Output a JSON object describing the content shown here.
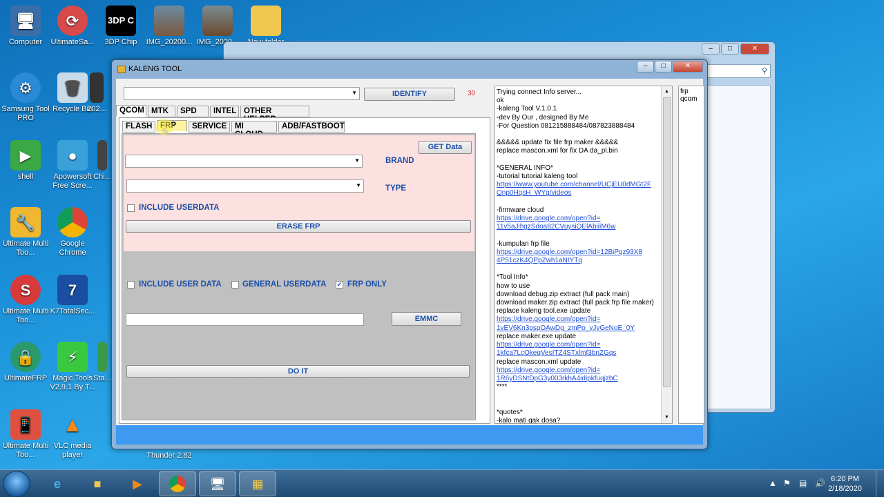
{
  "desktop": {
    "icons": [
      {
        "label": "Computer"
      },
      {
        "label": "UltimateSa..."
      },
      {
        "label": "3DP Chip",
        "glyph": "3DP C"
      },
      {
        "label": "IMG_20200..."
      },
      {
        "label": "IMG_2020..."
      },
      {
        "label": "New folder"
      },
      {
        "label": "Samsung Tool PRO"
      },
      {
        "label": "Recycle Bin"
      },
      {
        "label": "202..."
      },
      {
        "label": "shell"
      },
      {
        "label": "Apowersoft Free Scre..."
      },
      {
        "label": "Chi..."
      },
      {
        "label": "Ultimate Multi Too..."
      },
      {
        "label": "Google Chrome"
      },
      {
        "label": "Ultimate Multi Too..."
      },
      {
        "label": "K7TotalSec..."
      },
      {
        "label": "UltimateFRP"
      },
      {
        "label": "Magic Tools V2.9.1 By T..."
      },
      {
        "label": "Sta..."
      },
      {
        "label": "Ultimate Multi Too..."
      },
      {
        "label": "VLC media player"
      },
      {
        "label": "Thunder 2.82"
      }
    ]
  },
  "window": {
    "title": "KALENG TOOL",
    "minimize": "–",
    "maximize": "□",
    "close": "✕"
  },
  "top": {
    "device_combo_value": "",
    "identify_label": "IDENTIFY",
    "counter": "30"
  },
  "main_tabs": [
    "QCOM",
    "MTK",
    "SPD",
    "INTEL",
    "OTHER HELPER"
  ],
  "sub_tabs": [
    "FLASH",
    "FRP",
    "SERVICE",
    "MI CLOUD",
    "ADB/FASTBOOT"
  ],
  "frp_panel": {
    "get_data_label": "GET Data",
    "brand_label": "BRAND",
    "type_label": "TYPE",
    "include_userdata_label": "INCLUDE USERDATA",
    "erase_frp_label": "ERASE FRP"
  },
  "lower_panel": {
    "include_user_data_label": "INCLUDE USER DATA",
    "general_userdata_label": "GENERAL USERDATA",
    "frp_only_label": "FRP ONLY",
    "frp_only_checked": "✔",
    "emmc_label": "EMMC",
    "do_it_label": "DO IT"
  },
  "log_lines": [
    {
      "text": "Trying connect Info server...",
      "link": false
    },
    {
      "text": " ok",
      "link": false
    },
    {
      "text": "-kaleng Tool V.1.0.1",
      "link": false
    },
    {
      "text": "-dev By Our , designed By Me",
      "link": false
    },
    {
      "text": "-For Question 081215888484/087823888484",
      "link": false
    },
    {
      "text": "",
      "link": false
    },
    {
      "text": "&&&&& update fix file frp maker &&&&&",
      "link": false
    },
    {
      "text": "replace mascon.xml for fix DA da_pl.bin",
      "link": false
    },
    {
      "text": "",
      "link": false
    },
    {
      "text": "*GENERAL INFO*",
      "link": false
    },
    {
      "text": "-tutorial tutorial kaleng tool",
      "link": false
    },
    {
      "text": "https://www.youtube.com/channel/UCjEU0dMGt2F",
      "link": true
    },
    {
      "text": "Qnp0HqsH_WYg/videos",
      "link": true
    },
    {
      "text": "",
      "link": false
    },
    {
      "text": "-firmware cloud",
      "link": false
    },
    {
      "text": "https://drive.google.com/open?id=",
      "link": true
    },
    {
      "text": "11v5aJihgzSdoa82CVuysiQElAbiiiM6w",
      "link": true
    },
    {
      "text": "",
      "link": false
    },
    {
      "text": "-kumpulan frp file",
      "link": false
    },
    {
      "text": "https://drive.google.com/open?id=12BiPqz93X8",
      "link": true
    },
    {
      "text": "4P51czK4QPpZwh1aNtYTq",
      "link": true
    },
    {
      "text": "",
      "link": false
    },
    {
      "text": "*Tool Info*",
      "link": false
    },
    {
      "text": "how to use",
      "link": false
    },
    {
      "text": "download debug.zip extract (full pack main)",
      "link": false
    },
    {
      "text": "download maker.zip extract (full pack frp file maker)",
      "link": false
    },
    {
      "text": "replace kaleng tool.exe update",
      "link": false
    },
    {
      "text": "https://drive.google.com/open?id=",
      "link": true
    },
    {
      "text": "1vEV6Kn3pspOAwDg_zmPo_yJyGeNoE_0Y",
      "link": true
    },
    {
      "text": "replace maker.exe update",
      "link": false
    },
    {
      "text": "https://drive.google.com/open?id=",
      "link": true
    },
    {
      "text": "1kfca7LcOkeqVesITZ4STxlmf3bnZGqs",
      "link": true
    },
    {
      "text": "replace mascon.xml update",
      "link": false
    },
    {
      "text": "https://drive.google.com/open?id=",
      "link": true
    },
    {
      "text": "1R6yDSNtDpG3y003rkhA4idipkfuqjzbC",
      "link": true
    },
    {
      "text": "****",
      "link": false
    },
    {
      "text": "",
      "link": false
    },
    {
      "text": "",
      "link": false
    },
    {
      "text": "*quotes*",
      "link": false
    },
    {
      "text": "-kalo mati gak dosa?",
      "link": false
    }
  ],
  "side_list": {
    "item": "frp qcom"
  },
  "taskbar": {
    "time": "6:20 PM",
    "date": "2/18/2020"
  }
}
